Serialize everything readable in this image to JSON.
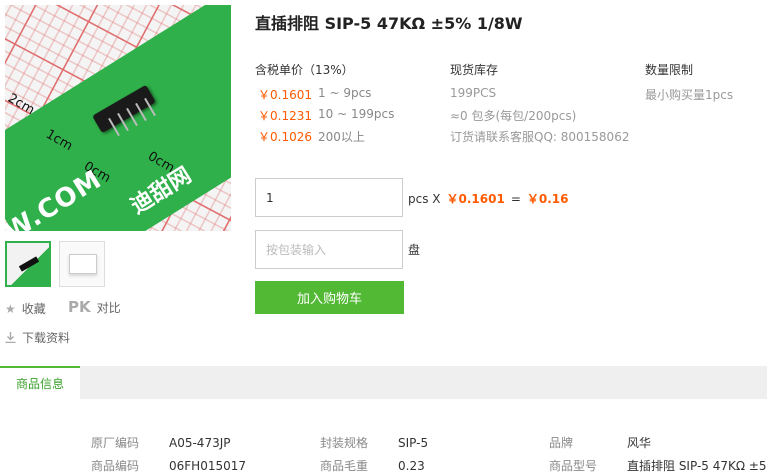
{
  "product": {
    "title": "直插排阻 SIP-5 47KΩ ±5% 1/8W"
  },
  "image": {
    "ruler_labels": [
      "2cm",
      "1cm",
      "0cm",
      "0cm"
    ],
    "watermark": "W.COM",
    "logo_text": "迪甜网"
  },
  "side_actions": {
    "favorite_label": "收藏",
    "pk_label": "PK",
    "compare_label": "对比",
    "download_label": "下载资料"
  },
  "pricing": {
    "header_price": "含税单价（13%）",
    "header_stock": "现货库存",
    "header_limit": "数量限制",
    "tiers": [
      {
        "price": "￥0.1601",
        "qty": "1 ~ 9pcs"
      },
      {
        "price": "￥0.1231",
        "qty": "10 ~ 199pcs"
      },
      {
        "price": "￥0.1026",
        "qty": "200以上"
      }
    ],
    "stock_lines": [
      "199PCS",
      "≈0 包多(每包/200pcs)",
      "订货请联系客服QQ: 800158062"
    ],
    "limit_text": "最小购买量1pcs"
  },
  "order": {
    "qty_value": "1",
    "unit_label": "pcs X",
    "unit_price": "￥0.1601",
    "equals": "=",
    "total": "￥0.16",
    "pack_placeholder": "按包装输入",
    "pack_unit": "盘",
    "add_to_cart": "加入购物车"
  },
  "tabs": {
    "active": "商品信息"
  },
  "specs": {
    "row1": [
      {
        "key": "原厂编码",
        "value": "A05-473JP"
      },
      {
        "key": "封装规格",
        "value": "SIP-5"
      },
      {
        "key": "品牌",
        "value": "风华"
      }
    ],
    "row2": [
      {
        "key": "商品编码",
        "value": "06FH015017"
      },
      {
        "key": "商品毛重",
        "value": "0.23"
      },
      {
        "key": "商品型号",
        "value": "直插排阻 SIP-5 47KΩ ±5..."
      }
    ]
  },
  "colors": {
    "accent_green": "#52b934",
    "price_orange": "#ff5a00"
  }
}
